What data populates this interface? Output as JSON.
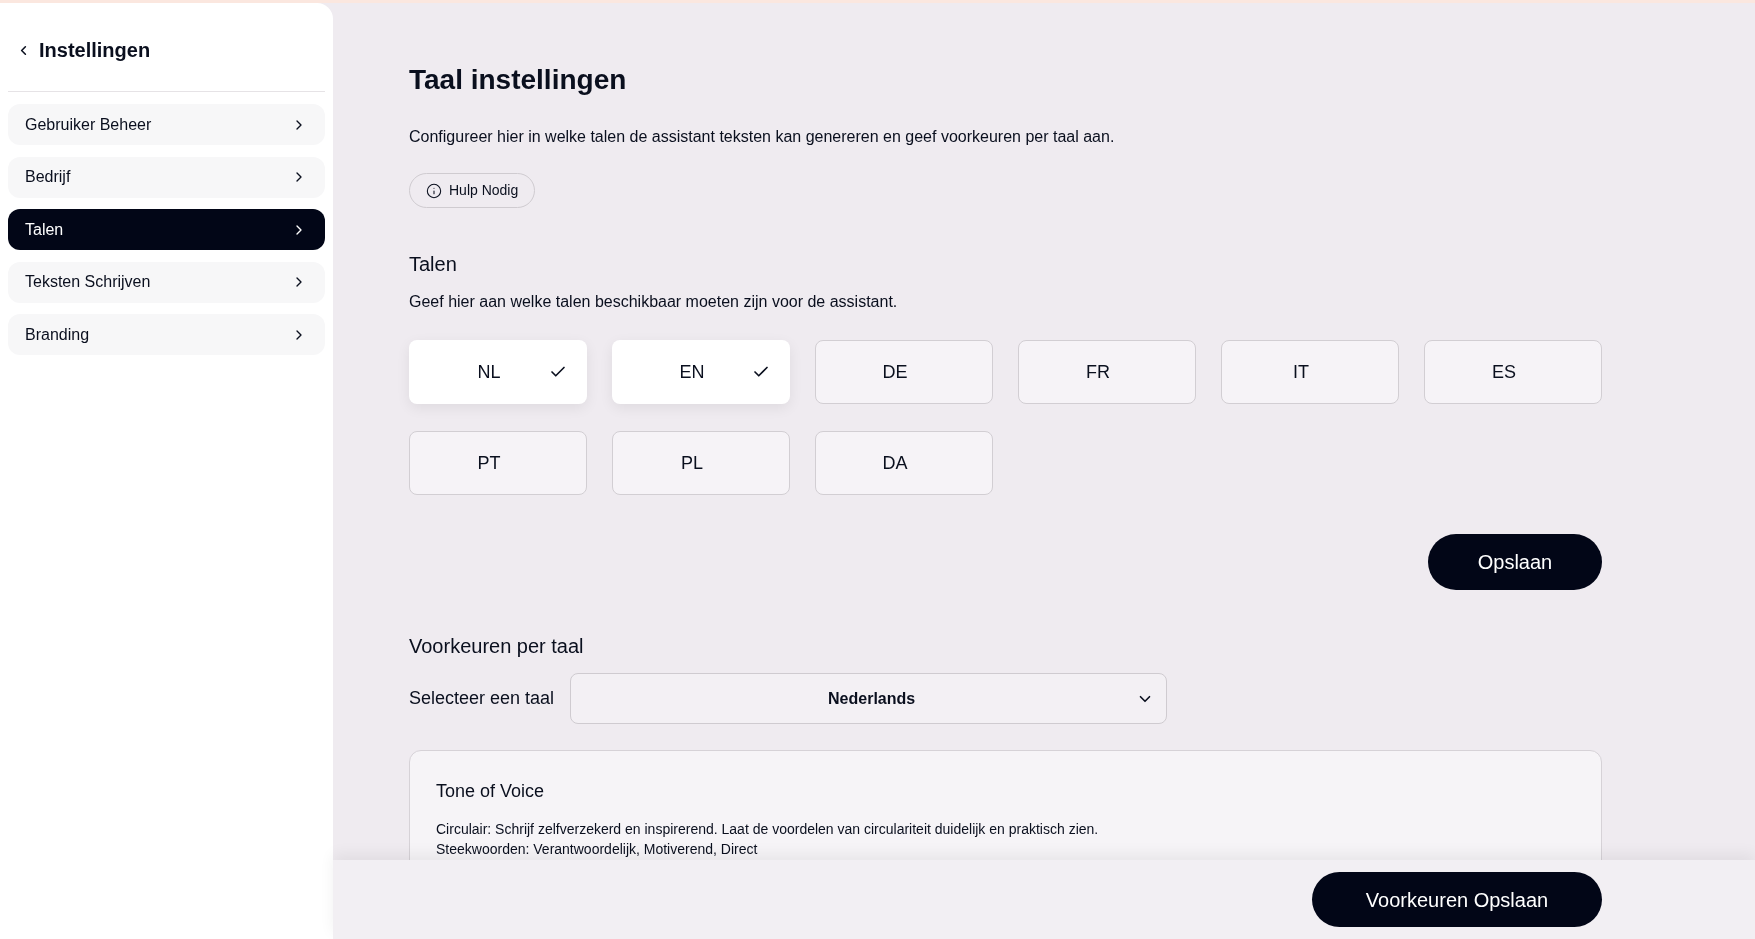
{
  "sidebar": {
    "title": "Instellingen",
    "items": [
      {
        "label": "Gebruiker Beheer",
        "selected": false
      },
      {
        "label": "Bedrijf",
        "selected": false
      },
      {
        "label": "Talen",
        "selected": true
      },
      {
        "label": "Teksten Schrijven",
        "selected": false
      },
      {
        "label": "Branding",
        "selected": false
      }
    ]
  },
  "page": {
    "title": "Taal instellingen",
    "description": "Configureer hier in welke talen de assistant teksten kan genereren en geef voorkeuren per taal aan.",
    "help_button": "Hulp Nodig"
  },
  "languages": {
    "heading": "Talen",
    "description": "Geef hier aan welke talen beschikbaar moeten zijn voor de assistant.",
    "options": [
      {
        "code": "NL",
        "checked": true
      },
      {
        "code": "EN",
        "checked": true
      },
      {
        "code": "DE",
        "checked": false
      },
      {
        "code": "FR",
        "checked": false
      },
      {
        "code": "IT",
        "checked": false
      },
      {
        "code": "ES",
        "checked": false
      },
      {
        "code": "PT",
        "checked": false
      },
      {
        "code": "PL",
        "checked": false
      },
      {
        "code": "DA",
        "checked": false
      }
    ],
    "save_button": "Opslaan"
  },
  "preferences": {
    "heading": "Voorkeuren per taal",
    "select_label": "Selecteer een taal",
    "select_value": "Nederlands",
    "tone_card": {
      "title": "Tone of Voice",
      "lines": [
        "Circulair: Schrijf zelfverzekerd en inspirerend. Laat de voordelen van circulariteit duidelijk en praktisch zien.",
        "Steekwoorden: Verantwoordelijk, Motiverend, Direct"
      ]
    }
  },
  "footer": {
    "save_button": "Voorkeuren Opslaan"
  }
}
